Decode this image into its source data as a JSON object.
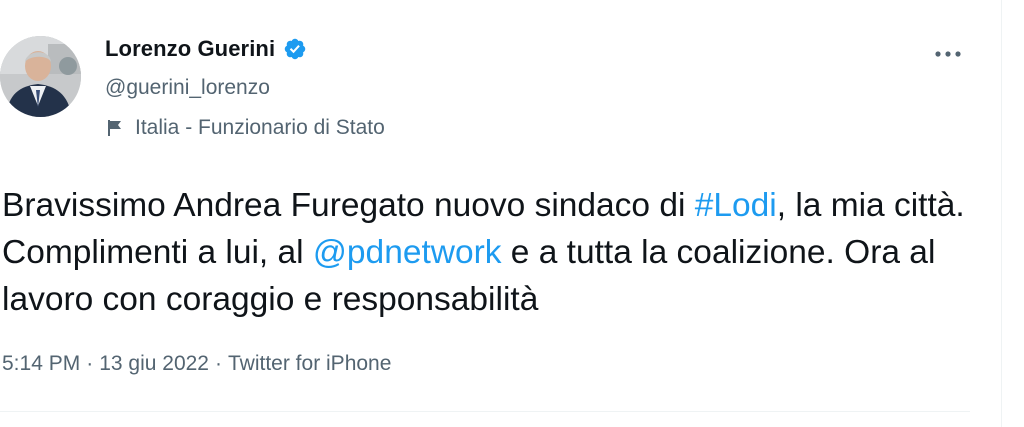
{
  "author": {
    "name": "Lorenzo Guerini",
    "handle": "@guerini_lorenzo",
    "label": "Italia - Funzionario di Stato",
    "verified": true
  },
  "tweet": {
    "segments": [
      "Bravissimo Andrea Furegato nuovo sindaco di ",
      "#Lodi",
      ", la mia città. Complimenti a lui, al ",
      "@pdnetwork",
      " e a tutta la coalizione. Ora al lavoro con coraggio e responsabilità"
    ],
    "time": "5:14 PM",
    "date": "13 giu 2022",
    "source": "Twitter for iPhone",
    "separator": "·"
  },
  "icons": {
    "verified": "verified-badge-icon",
    "flag": "flag-icon",
    "more": "more-options-icon"
  },
  "colors": {
    "link": "#1d9bf0",
    "secondary_text": "#536471",
    "primary_text": "#0f1419",
    "verified": "#1d9bf0"
  }
}
